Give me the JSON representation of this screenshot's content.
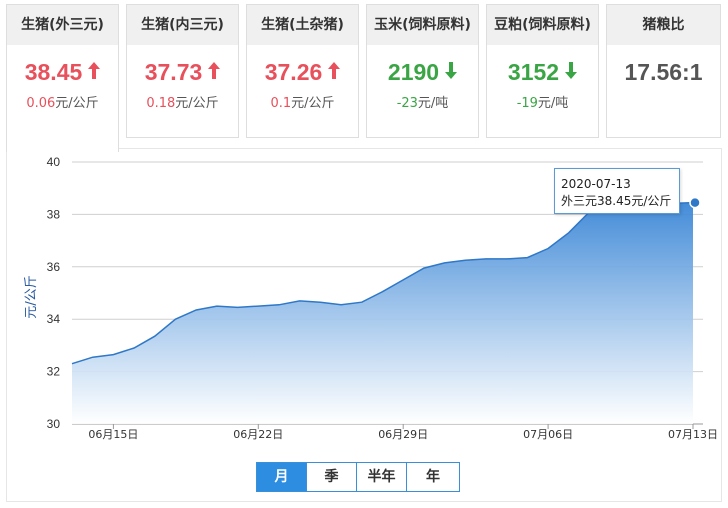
{
  "cards": [
    {
      "title": "生猪(外三元)",
      "value": "38.45",
      "trend": "up",
      "change_amount": "0.06",
      "change_unit": "元/公斤"
    },
    {
      "title": "生猪(内三元)",
      "value": "37.73",
      "trend": "up",
      "change_amount": "0.18",
      "change_unit": "元/公斤"
    },
    {
      "title": "生猪(土杂猪)",
      "value": "37.26",
      "trend": "up",
      "change_amount": "0.1",
      "change_unit": "元/公斤"
    },
    {
      "title": "玉米(饲料原料)",
      "value": "2190",
      "trend": "down",
      "change_amount": "-23",
      "change_unit": "元/吨"
    },
    {
      "title": "豆粕(饲料原料)",
      "value": "3152",
      "trend": "down",
      "change_amount": "-19",
      "change_unit": "元/吨"
    },
    {
      "title": "猪粮比",
      "value": "17.56:1",
      "trend": "none",
      "change_amount": "",
      "change_unit": ""
    }
  ],
  "colors": {
    "up": "#e8505b",
    "down": "#3aa545",
    "accent": "#2d8de0"
  },
  "range_buttons": [
    {
      "label": "月",
      "selected": true
    },
    {
      "label": "季",
      "selected": false
    },
    {
      "label": "半年",
      "selected": false
    },
    {
      "label": "年",
      "selected": false
    }
  ],
  "tooltip": {
    "date": "2020-07-13",
    "text": "外三元38.45元/公斤"
  },
  "chart_data": {
    "type": "area",
    "title": "",
    "xlabel": "",
    "ylabel": "元/公斤",
    "ylim": [
      30,
      40
    ],
    "yticks": [
      30,
      32,
      34,
      36,
      38,
      40
    ],
    "x_range": [
      "2020-06-13",
      "2020-07-13"
    ],
    "x_ticks": [
      {
        "date": "2020-06-15",
        "label": "06月15日"
      },
      {
        "date": "2020-06-22",
        "label": "06月22日"
      },
      {
        "date": "2020-06-29",
        "label": "06月29日"
      },
      {
        "date": "2020-07-06",
        "label": "07月06日"
      },
      {
        "date": "2020-07-13",
        "label": "07月13日"
      }
    ],
    "grid": true,
    "series": [
      {
        "x": [
          "2020-06-13",
          "2020-06-14",
          "2020-06-15",
          "2020-06-16",
          "2020-06-17",
          "2020-06-18",
          "2020-06-19",
          "2020-06-20",
          "2020-06-21",
          "2020-06-22",
          "2020-06-23",
          "2020-06-24",
          "2020-06-25",
          "2020-06-26",
          "2020-06-27",
          "2020-06-28",
          "2020-06-29",
          "2020-06-30",
          "2020-07-01",
          "2020-07-02",
          "2020-07-03",
          "2020-07-04",
          "2020-07-05",
          "2020-07-06",
          "2020-07-07",
          "2020-07-08",
          "2020-07-09",
          "2020-07-10",
          "2020-07-11",
          "2020-07-12",
          "2020-07-13"
        ],
        "values": [
          32.3,
          32.55,
          32.65,
          32.9,
          33.35,
          34.0,
          34.35,
          34.5,
          34.45,
          34.5,
          34.55,
          34.7,
          34.65,
          34.55,
          34.65,
          35.05,
          35.5,
          35.95,
          36.15,
          36.25,
          36.3,
          36.3,
          36.35,
          36.7,
          37.3,
          38.1,
          38.3,
          38.4,
          38.4,
          38.42,
          38.45
        ]
      }
    ]
  }
}
